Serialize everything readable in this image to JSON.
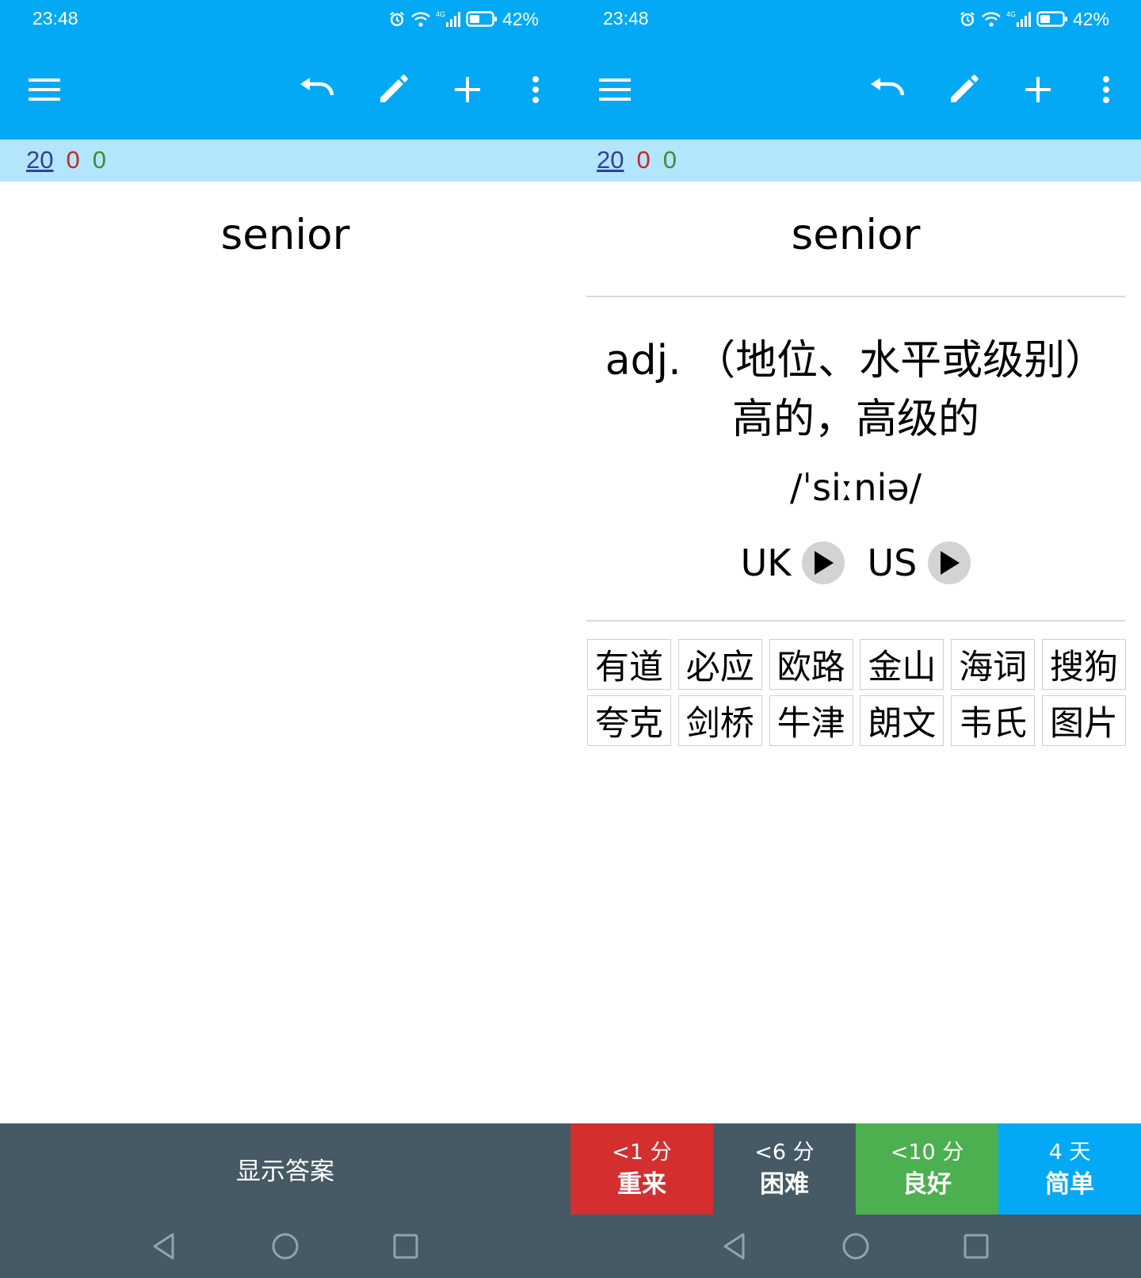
{
  "status": {
    "time": "23:48",
    "network": "4G",
    "battery": "42%"
  },
  "toolbar": {
    "icons": [
      "menu-icon",
      "undo-icon",
      "edit-icon",
      "add-icon",
      "more-vert-icon"
    ]
  },
  "counts": {
    "new": "20",
    "learning": "0",
    "review": "0"
  },
  "colors": {
    "primary": "#03a9f4",
    "counts_bar": "#b3e5fc",
    "bottom_bar": "#455a64",
    "again": "#d32f2f",
    "hard": "#455a64",
    "good": "#4caf50",
    "easy": "#03a9f4"
  },
  "front": {
    "word": "senior",
    "show_answer": "显示答案"
  },
  "back": {
    "word": "senior",
    "meaning_line1": "adj. （地位、水平或级别）",
    "meaning_line2": "高的，高级的",
    "phonetic": "/ˈsiːniə/",
    "audio": [
      {
        "label": "UK"
      },
      {
        "label": "US"
      }
    ],
    "dictionaries": [
      "有道",
      "必应",
      "欧路",
      "金山",
      "海词",
      "搜狗",
      "夸克",
      "剑桥",
      "牛津",
      "朗文",
      "韦氏",
      "图片"
    ],
    "answer_buttons": [
      {
        "time": "<1 分",
        "label": "重来"
      },
      {
        "time": "<6 分",
        "label": "困难"
      },
      {
        "time": "<10 分",
        "label": "良好"
      },
      {
        "time": "4 天",
        "label": "简单"
      }
    ]
  },
  "navbar": {
    "icons": [
      "back-icon",
      "home-icon",
      "recents-icon"
    ]
  }
}
